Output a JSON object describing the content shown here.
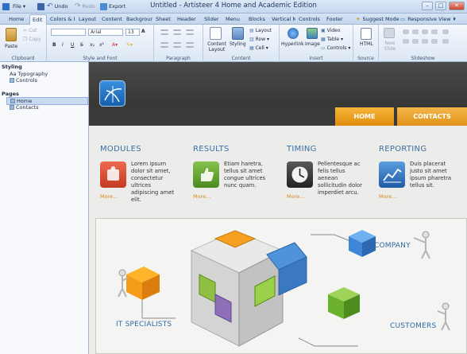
{
  "window": {
    "title": "Untitled - Artisteer 4 Home and Academic Edition",
    "qat": {
      "file": "File",
      "undo": "Undo",
      "redo": "Redo",
      "export": "Export"
    }
  },
  "tabs": [
    {
      "label": "Home",
      "active": false
    },
    {
      "label": "Edit",
      "active": true
    },
    {
      "label": "Colors & F",
      "active": false
    },
    {
      "label": "Layout",
      "active": false
    },
    {
      "label": "Content",
      "active": false
    },
    {
      "label": "Backgrour",
      "active": false
    },
    {
      "label": "Sheet",
      "active": false
    },
    {
      "label": "Header",
      "active": false
    },
    {
      "label": "Slider",
      "active": false
    },
    {
      "label": "Menu",
      "active": false
    },
    {
      "label": "Blocks",
      "active": false
    },
    {
      "label": "Vertical M",
      "active": false
    },
    {
      "label": "Controls",
      "active": false
    },
    {
      "label": "Footer",
      "active": false
    }
  ],
  "tabbar_right": {
    "suggest": "Suggest Mode",
    "responsive": "Responsive View"
  },
  "ribbon": {
    "clipboard": {
      "paste": "Paste",
      "cut": "Cut",
      "copy": "Copy",
      "label": "Clipboard"
    },
    "font": {
      "font_name": "Arial",
      "font_size": "13",
      "bold": "B",
      "italic": "I",
      "underline": "U",
      "label": "Style and Font"
    },
    "paragraph": {
      "label": "Paragraph"
    },
    "content": {
      "content_layout": "Content Layout",
      "styling": "Styling",
      "layout": "Layout",
      "row": "Row",
      "cell": "Cell",
      "label": "Content"
    },
    "insert": {
      "hyperlink": "Hyperlink",
      "image": "Image",
      "video": "Video",
      "table": "Table",
      "controls": "Controls",
      "label": "Insert"
    },
    "source": {
      "html": "HTML",
      "label": "Source"
    },
    "slideshow": {
      "new_slide": "New Slide",
      "label": "Slideshow"
    }
  },
  "left_panel": {
    "styling_header": "Styling",
    "styling_items": [
      "Aa Typography",
      "Controls"
    ],
    "pages_header": "Pages",
    "pages": [
      {
        "label": "Home",
        "selected": true
      },
      {
        "label": "Contacts",
        "selected": false
      }
    ]
  },
  "site": {
    "nav": [
      "HOME",
      "CONTACTS"
    ],
    "features": [
      {
        "title": "MODULES",
        "text": "Lorem ipsum dolor sit amet, consectetur ultrices adipiscing amet elit.",
        "more": "More...",
        "color": "#d9412b"
      },
      {
        "title": "RESULTS",
        "text": "Etiam haretra, tellus sit amet congue ultrices nunc quam.",
        "more": "More...",
        "color": "#5a9a2a"
      },
      {
        "title": "TIMING",
        "text": "Pellentesque ac felis tellus aenean sollicitudin dolor imperdiet arcu.",
        "more": "More...",
        "color": "#3b3b3b"
      },
      {
        "title": "REPORTING",
        "text": "Duis placerat justo sit amet ipsum pharetra tellus sit.",
        "more": "More...",
        "color": "#2f6db5"
      }
    ],
    "banner": {
      "left": "IT SPECIALISTS",
      "company": "COMPANY",
      "customers": "CUSTOMERS"
    }
  },
  "colors": {
    "accent_orange": "#f0a21b",
    "title_blue": "#3d6fa3",
    "header_dark": "#3a3a38"
  }
}
